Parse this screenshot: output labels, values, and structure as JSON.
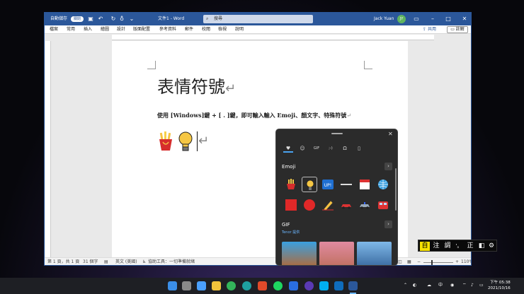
{
  "window": {
    "autosave_label": "自動儲存",
    "autosave_state": "關閉",
    "title": "文件1 - Word",
    "search_placeholder": "搜尋",
    "user": "Jack Yuan",
    "avatar_initials": "JY"
  },
  "menu": {
    "items": [
      "檔案",
      "常用",
      "插入",
      "繪圖",
      "設計",
      "版面配置",
      "參考資料",
      "郵件",
      "校閱",
      "檢視",
      "說明"
    ],
    "share": "共用",
    "comment": "註解"
  },
  "document": {
    "heading": "表情符號",
    "paragraph_mark": "↵",
    "body": "使用 [Windows]鍵 + [ . ]鍵，即可輸入輸入 Emoji、顏文字、特殊符號",
    "emojis": [
      "french-fries",
      "light-bulb"
    ]
  },
  "status": {
    "page": "第 1 頁，共 1 頁",
    "words": "31 個字",
    "language": "英文 (美國)",
    "accessibility": "協助工具：一切準備就緒",
    "zoom": "110%"
  },
  "emoji_panel": {
    "tabs": [
      "emoji-tab",
      "kaomoji-smiley-tab",
      "gif-tab",
      "kaomoji-tab",
      "symbols-tab",
      "clipboard-tab"
    ],
    "tab_glyphs": [
      "♥",
      "☺",
      "GIF",
      ";-)",
      "Ω",
      "📋"
    ],
    "section_emoji": "Emoji",
    "section_gif": "GIF",
    "tenor": "Tenor 提供",
    "row1": [
      "french-fries",
      "light-bulb",
      "up-button",
      "heavy-minus",
      "calendar",
      "globe"
    ],
    "row2": [
      "red-square",
      "red-circle",
      "pencil",
      "car",
      "police-car",
      "tram"
    ]
  },
  "ime": {
    "keys": [
      "自",
      "注",
      "調",
      "'。",
      "正"
    ]
  },
  "taskbar": {
    "clock_time": "下午 05:38",
    "clock_date": "2021/10/16",
    "lang": "中"
  },
  "colors": {
    "word_blue": "#2b579a",
    "panel_bg": "#2b2b2b",
    "taskbar_bg": "#1e1f24",
    "accent": "#0078d4"
  }
}
